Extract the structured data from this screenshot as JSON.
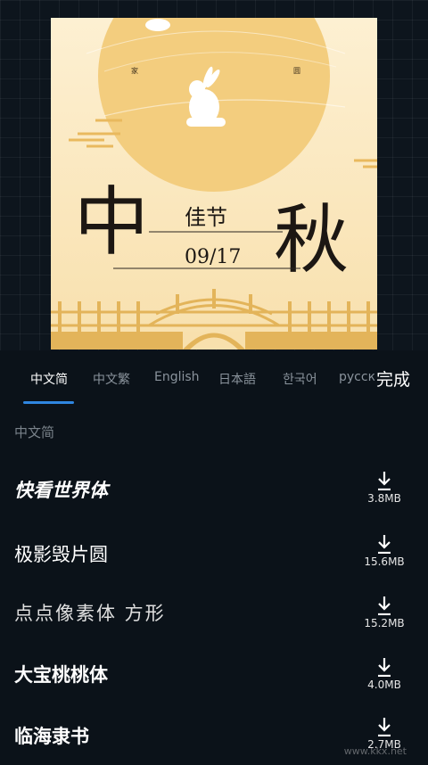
{
  "poster": {
    "small_left": "家",
    "small_right": "圆",
    "big_left": "中",
    "big_right": "秋",
    "subtitle": "佳节",
    "date": "09/17"
  },
  "tabs": [
    {
      "label": "中文简",
      "active": true
    },
    {
      "label": "中文繁",
      "active": false
    },
    {
      "label": "English",
      "active": false
    },
    {
      "label": "日本語",
      "active": false
    },
    {
      "label": "한국어",
      "active": false
    },
    {
      "label": "русский",
      "active": false
    }
  ],
  "done_label": "完成",
  "section_label": "中文简",
  "fonts": [
    {
      "name": "快看世界体",
      "size": "3.8MB"
    },
    {
      "name": "极影毁片圆",
      "size": "15.6MB"
    },
    {
      "name": "点点像素体 方形",
      "size": "15.2MB"
    },
    {
      "name": "大宝桃桃体",
      "size": "4.0MB"
    },
    {
      "name": "临海隶书",
      "size": "2.7MB"
    }
  ],
  "watermark": "www.kkx.net",
  "colors": {
    "background": "#0b1219",
    "accent": "#2f86e0",
    "poster_bg": "#fbe9c3",
    "moon": "#f3cd7e"
  }
}
